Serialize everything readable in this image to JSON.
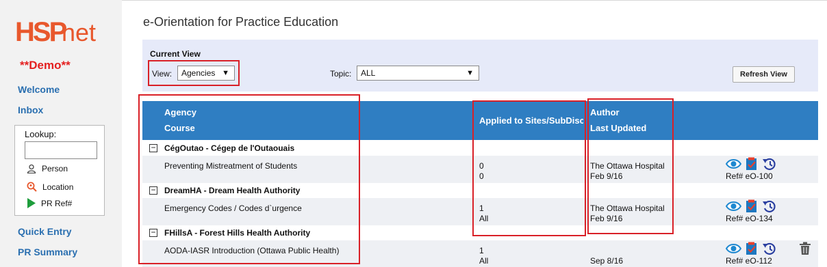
{
  "sidebar": {
    "logo": {
      "hsp": "HSP",
      "net": "net",
      "brand_color": "#e8582d"
    },
    "demo_label": "**Demo**",
    "links": {
      "welcome": "Welcome",
      "inbox": "Inbox",
      "quick_entry": "Quick Entry",
      "pr_summary": "PR Summary"
    },
    "lookup": {
      "title": "Lookup:",
      "input_value": "",
      "person": "Person",
      "location": "Location",
      "pr_ref": "PR Ref#"
    }
  },
  "page": {
    "title": "e-Orientation for Practice Education"
  },
  "current_view": {
    "title": "Current View",
    "view_label": "View:",
    "view_value": "Agencies",
    "topic_label": "Topic:",
    "topic_value": "ALL",
    "refresh_label": "Refresh View"
  },
  "table": {
    "header": {
      "agency": "Agency",
      "course": "Course",
      "applied": "Applied to Sites/SubDisc",
      "author": "Author",
      "last_updated": "Last Updated"
    },
    "groups": [
      {
        "label": "CégOutao - Cégep de l'Outaouais",
        "row": {
          "course": "Preventing Mistreatment of Students",
          "applied_line1": "0",
          "applied_line2": "0",
          "author": "The Ottawa Hospital",
          "updated": "Feb 9/16",
          "ref": "Ref# eO-100"
        }
      },
      {
        "label": "DreamHA - Dream Health Authority",
        "row": {
          "course": "Emergency Codes / Codes d`urgence",
          "applied_line1": "1",
          "applied_line2": "All",
          "author": "The Ottawa Hospital",
          "updated": "Feb 9/16",
          "ref": "Ref# eO-134"
        }
      },
      {
        "label": "FHillsA - Forest Hills Health Authority",
        "row": {
          "course": "AODA-IASR Introduction (Ottawa Public Health)",
          "applied_line1": "1",
          "applied_line2": "All",
          "author": "",
          "updated": "Sep 8/16",
          "ref": "Ref# eO-112"
        }
      }
    ]
  },
  "colors": {
    "accent_blue": "#2f7ec2",
    "link_blue": "#2a6fb0",
    "highlight_red": "#d92027",
    "panel_bg": "#e6eaf9"
  },
  "icons": [
    "eye-icon",
    "checklist-icon",
    "history-icon",
    "trash-icon",
    "person-icon",
    "location-search-icon",
    "play-icon"
  ]
}
